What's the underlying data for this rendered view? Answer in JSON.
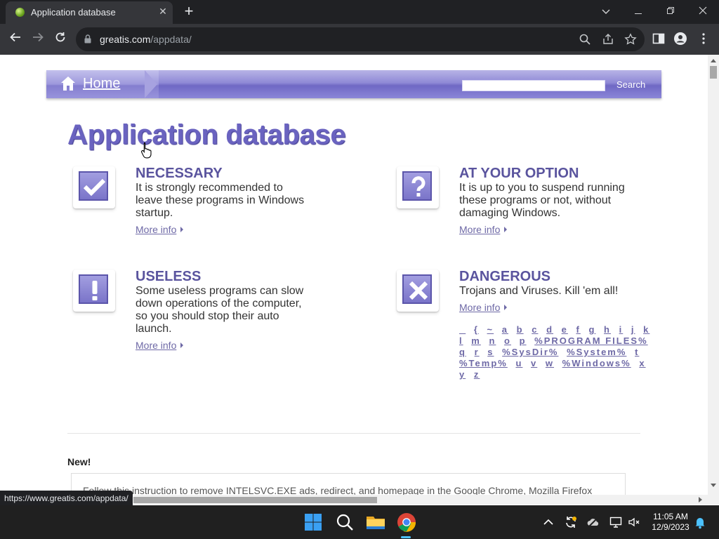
{
  "browser": {
    "tab_title": "Application database",
    "new_tab_symbol": "+",
    "url_host": "greatis.com",
    "url_path": "/appdata/",
    "status_url": "https://www.greatis.com/appdata/",
    "icons": [
      "back-icon",
      "forward-icon",
      "reload-icon",
      "lock-icon",
      "search-icon",
      "share-icon",
      "star-icon",
      "sidebar-icon",
      "profile-icon",
      "menu-icon"
    ]
  },
  "site": {
    "home_label": "Home",
    "search_label": "Search",
    "search_value": "",
    "page_title": "Application database",
    "brand_color": "#6a63c0",
    "categories": [
      {
        "title": "NECESSARY",
        "description": "It is strongly recommended to leave these programs in Windows startup.",
        "more": "More info",
        "icon": "checkmark-icon"
      },
      {
        "title": "AT YOUR OPTION",
        "description": "It is up to you to suspend running these programs or not, without damaging Windows.",
        "more": "More info",
        "icon": "question-icon"
      },
      {
        "title": "USELESS",
        "description": "Some useless programs can slow down operations of the computer, so you should stop their auto launch.",
        "more": "More info",
        "icon": "exclamation-icon"
      },
      {
        "title": "DANGEROUS",
        "description": "Trojans and Viruses. Kill 'em all!",
        "more": "More info",
        "icon": "x-mark-icon"
      }
    ],
    "alpha_index": [
      "_",
      "{",
      "~",
      "a",
      "b",
      "c",
      "d",
      "e",
      "f",
      "g",
      "h",
      "i",
      "j",
      "k",
      "l",
      "m",
      "n",
      "o",
      "p",
      "%PROGRAM FILES%",
      "q",
      "r",
      "s",
      "%SysDir%",
      "%System%",
      "t",
      "%Temp%",
      "u",
      "v",
      "w",
      "%Windows%",
      "x",
      "y",
      "z"
    ],
    "new_label": "New!",
    "news_text": "Follow this instruction to remove INTELSVC.EXE ads, redirect, and homepage in the Google Chrome, Mozilla Firefox"
  },
  "taskbar": {
    "time": "11:05 AM",
    "date": "12/9/2023",
    "accent": "#4cc2ff"
  }
}
